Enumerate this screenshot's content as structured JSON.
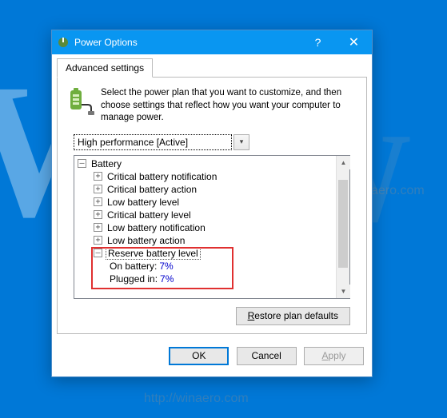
{
  "titlebar": {
    "title": "Power Options"
  },
  "tab": {
    "label": "Advanced settings"
  },
  "intro": {
    "text": "Select the power plan that you want to customize, and then choose settings that reflect how you want your computer to manage power."
  },
  "plan": {
    "selected": "High performance [Active]"
  },
  "tree": {
    "root": "Battery",
    "items": [
      "Critical battery notification",
      "Critical battery action",
      "Low battery level",
      "Critical battery level",
      "Low battery notification",
      "Low battery action"
    ],
    "expanded": {
      "label": "Reserve battery level",
      "on_battery_label": "On battery:",
      "on_battery_val": "7%",
      "plugged_label": "Plugged in:",
      "plugged_val": "7%"
    }
  },
  "buttons": {
    "restore": "Restore plan defaults",
    "ok": "OK",
    "cancel": "Cancel",
    "apply": "Apply"
  },
  "watermark": "http://winaero.com"
}
